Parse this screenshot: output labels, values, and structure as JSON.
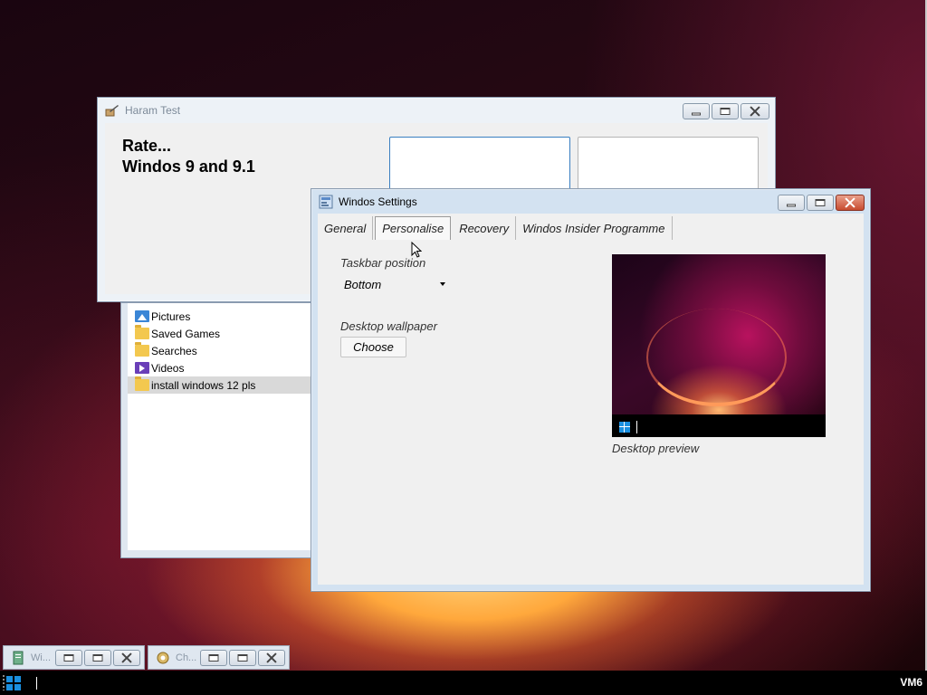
{
  "desktop": {
    "accent": "#1a8fe0"
  },
  "haram_window": {
    "title": "Haram Test",
    "heading_line1": "Rate...",
    "heading_line2": "Windos 9 and 9.1"
  },
  "explorer": {
    "items": [
      {
        "label": "Pictures",
        "icon": "pictures-folder-icon"
      },
      {
        "label": "Saved Games",
        "icon": "folder-icon"
      },
      {
        "label": "Searches",
        "icon": "folder-icon"
      },
      {
        "label": "Videos",
        "icon": "videos-folder-icon"
      },
      {
        "label": "install windows 12 pls",
        "icon": "folder-icon",
        "selected": true
      }
    ]
  },
  "settings_window": {
    "title": "Windos Settings",
    "tabs": [
      {
        "label": "General"
      },
      {
        "label": "Personalise",
        "active": true
      },
      {
        "label": "Recovery"
      },
      {
        "label": "Windos Insider Programme"
      }
    ],
    "taskbar_position_label": "Taskbar position",
    "taskbar_position_value": "Bottom",
    "wallpaper_label": "Desktop wallpaper",
    "choose_label": "Choose",
    "preview_caption": "Desktop preview"
  },
  "taskbar": {
    "minimized": [
      {
        "title": "Wi..."
      },
      {
        "title": "Ch..."
      }
    ],
    "tray_label": "VM6"
  }
}
